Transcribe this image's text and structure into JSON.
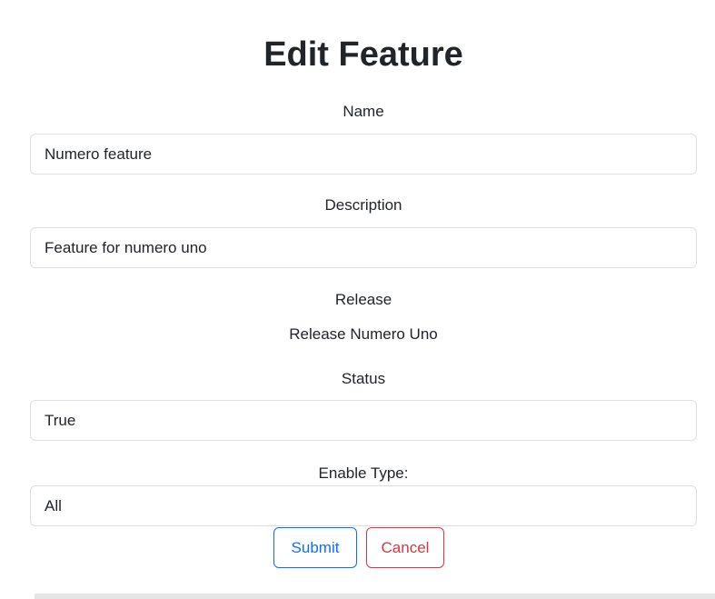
{
  "form": {
    "title": "Edit Feature",
    "name_label": "Name",
    "name_value": "Numero feature",
    "description_label": "Description",
    "description_value": "Feature for numero uno",
    "release_label": "Release",
    "release_value": "Release Numero Uno",
    "status_label": "Status",
    "status_value": "True",
    "enable_type_label": "Enable Type:",
    "enable_type_value": "All"
  },
  "actions": {
    "submit_label": "Submit",
    "cancel_label": "Cancel"
  },
  "colors": {
    "primary": "#0d6efd",
    "danger": "#dc3545",
    "text": "#212529",
    "input_border": "#dcdfe3"
  }
}
